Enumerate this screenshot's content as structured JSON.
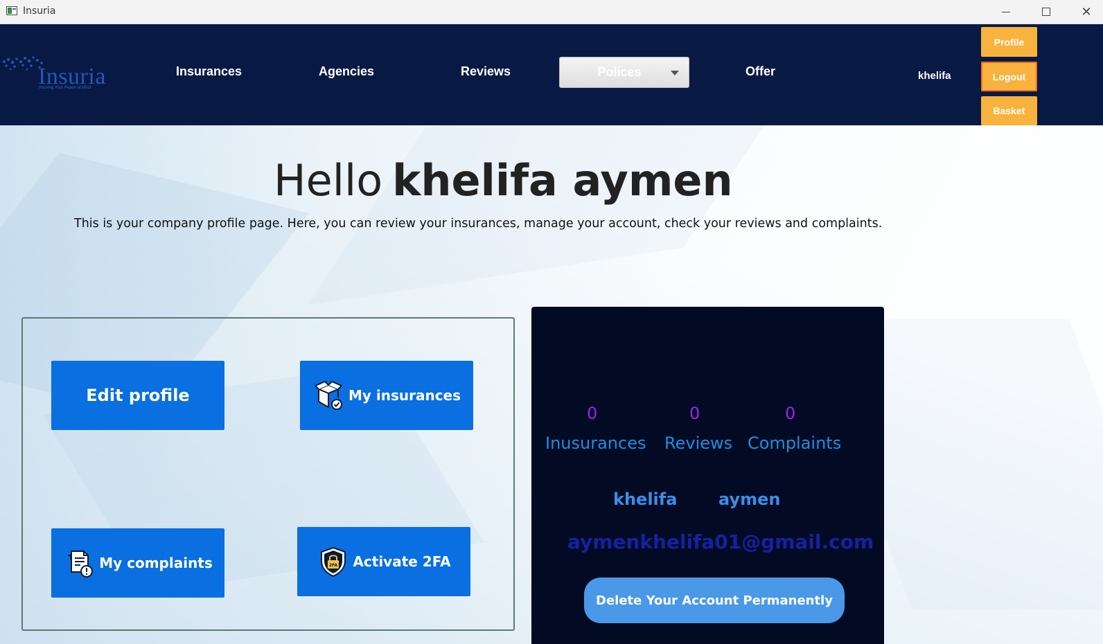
{
  "window": {
    "title": "Insuria",
    "min_icon": "minimize-icon",
    "max_icon": "maximize-icon",
    "close_icon": "close-icon",
    "close_glyph": "✕"
  },
  "nav": {
    "logo_text": "Insuria",
    "logo_tagline": "Insuring Your Peace of Mind",
    "links": {
      "insurances": "Insurances",
      "agencies": "Agencies",
      "reviews": "Reviews",
      "polices": "Polices",
      "offer": "Offer"
    },
    "username": "khelifa",
    "profile_label": "Profile",
    "logout_label": "Logout",
    "basket_label": "Basket"
  },
  "main": {
    "greeting_hello": "Hello",
    "greeting_name": "khelifa aymen",
    "intro": "This is your company profile page. Here, you can review your insurances, manage your account, check your reviews and complaints."
  },
  "actions": {
    "edit_profile": "Edit profile",
    "my_insurances": "My insurances",
    "my_complaints": "My complaints",
    "activate_2fa": "Activate 2FA"
  },
  "stats": {
    "insurances_count": "0",
    "insurances_label": "Inusurances",
    "reviews_count": "0",
    "reviews_label": "Reviews",
    "complaints_count": "0",
    "complaints_label": "Complaints",
    "first_name": "khelifa",
    "last_name": "aymen",
    "email": "aymenkhelifa01@gmail.com",
    "delete_label": "Delete Your Account Permanently"
  },
  "colors": {
    "nav_bg": "#081a44",
    "accent_orange": "#f8b23e",
    "action_blue": "#0a6fe0",
    "card_bg": "#030b24",
    "stat_number": "#a020f0",
    "stat_label": "#1f8ee0"
  }
}
